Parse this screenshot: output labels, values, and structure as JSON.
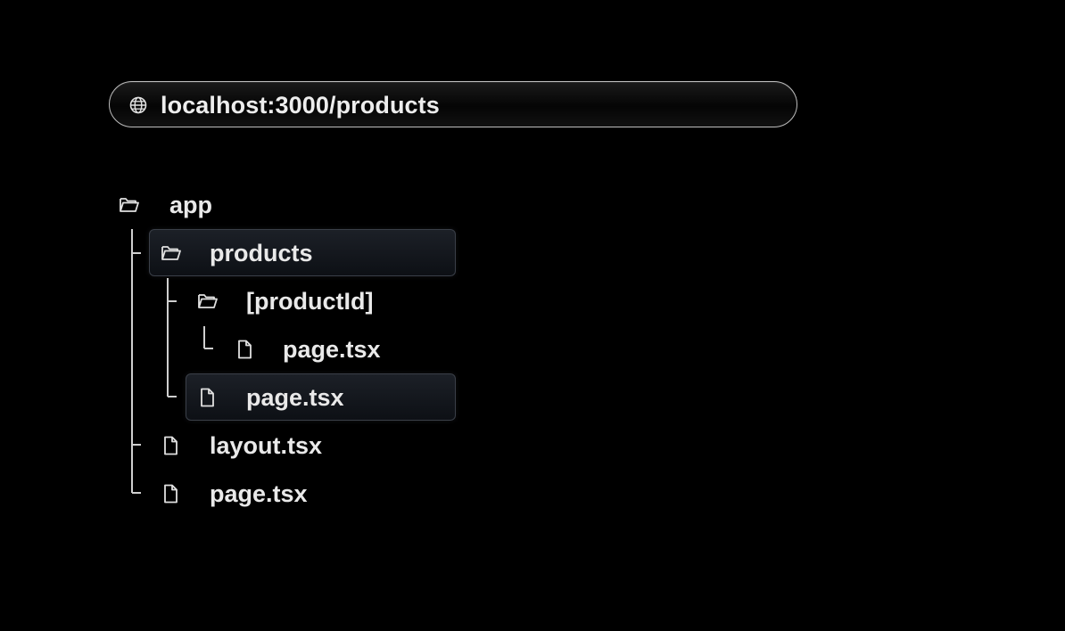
{
  "address_bar": {
    "url": "localhost:3000/products",
    "icon": "globe-icon"
  },
  "tree": {
    "root": {
      "label": "app",
      "icon": "folder-open-icon"
    },
    "products": {
      "label": "products",
      "icon": "folder-open-icon",
      "highlighted": true
    },
    "product_id": {
      "label": "[productId]",
      "icon": "folder-open-icon"
    },
    "product_id_page": {
      "label": "page.tsx",
      "icon": "file-icon"
    },
    "products_page": {
      "label": "page.tsx",
      "icon": "file-icon",
      "highlighted": true
    },
    "layout": {
      "label": "layout.tsx",
      "icon": "file-icon"
    },
    "root_page": {
      "label": "page.tsx",
      "icon": "file-icon"
    }
  },
  "colors": {
    "background": "#000000",
    "text": "#e9e9e9",
    "highlight_border": "#3a3f48",
    "tree_line": "#cfcfcf"
  }
}
